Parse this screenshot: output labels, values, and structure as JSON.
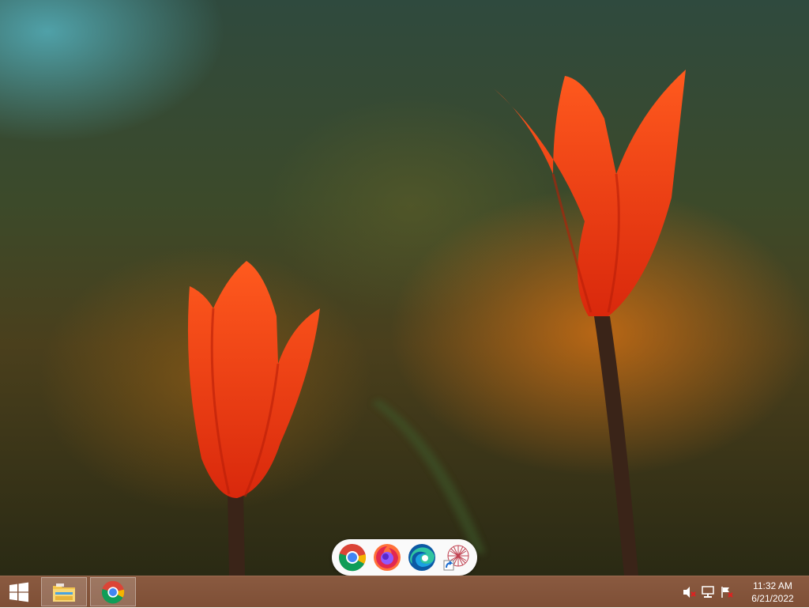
{
  "desktop": {
    "wallpaper": "two orange tulips on blurred background"
  },
  "floating_dock": {
    "items": [
      {
        "icon": "chrome-icon"
      },
      {
        "icon": "firefox-icon"
      },
      {
        "icon": "edge-icon"
      },
      {
        "icon": "app-shortcut-icon"
      }
    ]
  },
  "taskbar": {
    "color": "#7e4f36",
    "pinned": [
      {
        "icon": "file-explorer-icon"
      },
      {
        "icon": "chrome-icon"
      }
    ],
    "tray": {
      "icons": [
        "speaker-muted-icon",
        "network-icon",
        "action-center-flag-icon"
      ],
      "time": "11:32 AM",
      "date": "6/21/2022"
    }
  }
}
